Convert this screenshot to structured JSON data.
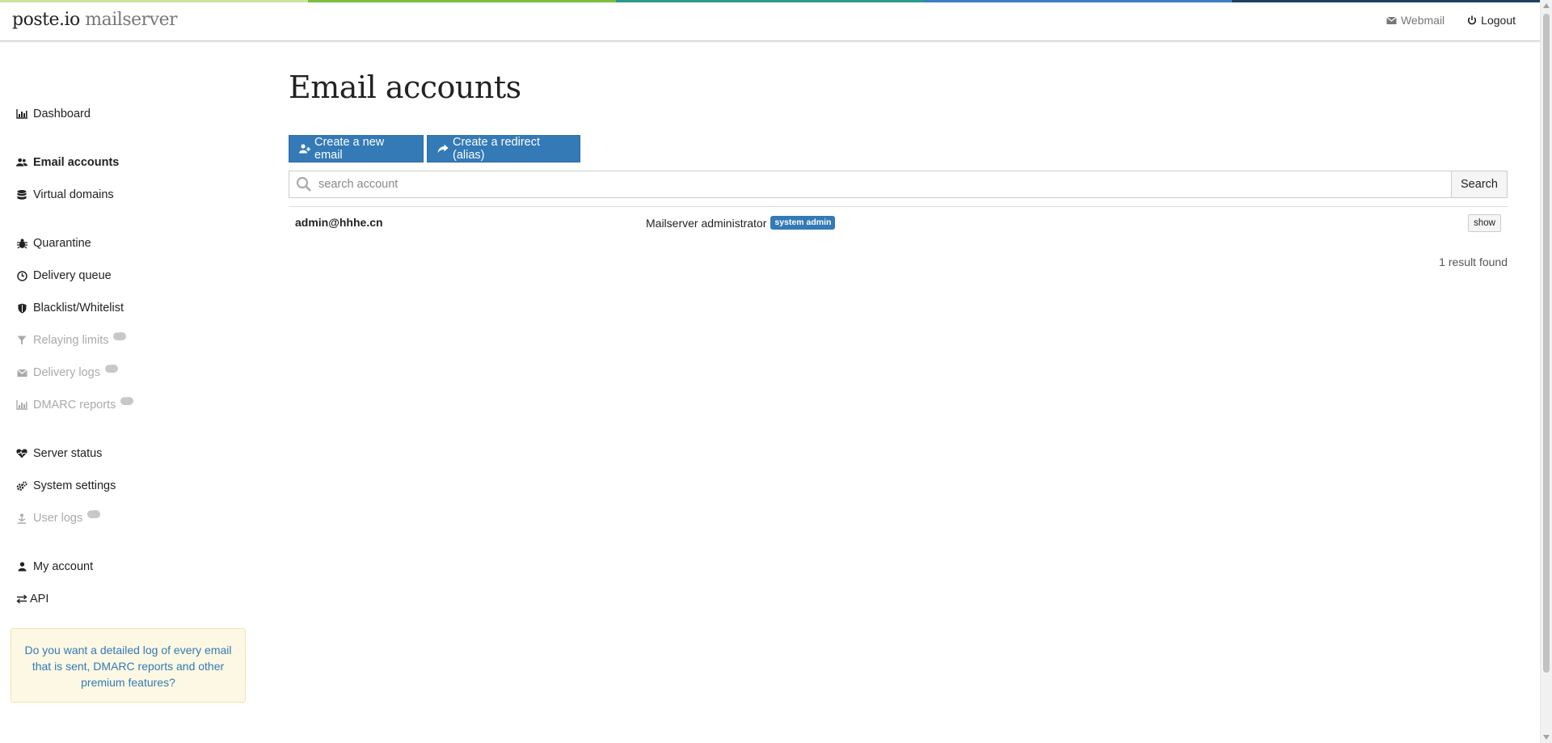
{
  "colors": {
    "stripe": [
      "#c8e6a0",
      "#7cbf3e",
      "#2b9a8a",
      "#3a7fc4",
      "#1f3f66"
    ],
    "accent": "#337ab7",
    "promo_bg": "#fcf8e3"
  },
  "header": {
    "brand_main": "poste.io",
    "brand_sub": "mailserver",
    "links": {
      "webmail": "Webmail",
      "logout": "Logout"
    }
  },
  "sidebar": {
    "items": [
      {
        "label": "Dashboard",
        "icon": "bar-chart-icon"
      },
      {
        "label": "Email accounts",
        "icon": "users-icon",
        "active": true
      },
      {
        "label": "Virtual domains",
        "icon": "database-icon"
      },
      {
        "label": "Quarantine",
        "icon": "bug-icon"
      },
      {
        "label": "Delivery queue",
        "icon": "clock-icon"
      },
      {
        "label": "Blacklist/Whitelist",
        "icon": "shield-icon"
      },
      {
        "label": "Relaying limits",
        "icon": "filter-icon",
        "disabled": true,
        "premium": true
      },
      {
        "label": "Delivery logs",
        "icon": "envelope-icon",
        "disabled": true,
        "premium": true
      },
      {
        "label": "DMARC reports",
        "icon": "bar-chart-icon",
        "disabled": true,
        "premium": true
      },
      {
        "label": "Server status",
        "icon": "heartbeat-icon"
      },
      {
        "label": "System settings",
        "icon": "cogs-icon"
      },
      {
        "label": "User logs",
        "icon": "user-logs-icon",
        "disabled": true,
        "premium": true
      },
      {
        "label": "My account",
        "icon": "user-icon"
      },
      {
        "label": "API",
        "icon": "exchange-icon"
      }
    ],
    "promo_text": "Do you want a detailed log of every email that is sent, DMARC reports and other premium features?"
  },
  "main": {
    "title": "Email accounts",
    "buttons": {
      "create_email": "Create a new email",
      "create_redirect": "Create a redirect (alias)"
    },
    "search": {
      "placeholder": "search account",
      "button": "Search"
    },
    "results": [
      {
        "email": "admin@hhhe.cn",
        "name": "Mailserver administrator",
        "badge": "system admin",
        "action": "show"
      }
    ],
    "result_count": "1 result found"
  }
}
